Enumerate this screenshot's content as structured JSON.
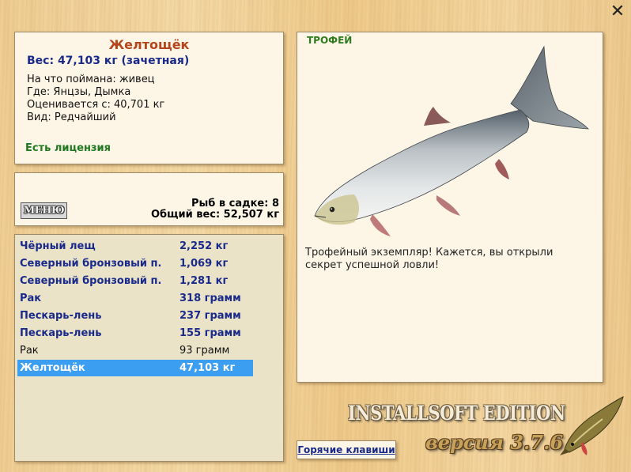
{
  "close_glyph": "✕",
  "fish_card": {
    "name": "Желтощёк",
    "weight_line": "Вес: 47,103 кг (зачетная)",
    "caught_on": "На что поймана: живец",
    "location": "Где: Янцзы, Дымка",
    "rated_from": "Оценивается с: 40,701 кг",
    "kind": "Вид: Редчайший",
    "license": "Есть лицензия"
  },
  "cage": {
    "menu_label": "МЕНЮ",
    "fish_count": "Рыб в садке: 8",
    "total_weight": "Общий вес: 52,507 кг"
  },
  "catch_list": [
    {
      "name": "Чёрный лещ",
      "weight": "2,252 кг",
      "style": "hi"
    },
    {
      "name": "Северный бронзовый п...",
      "weight": "1,069 кг",
      "style": "hi"
    },
    {
      "name": "Северный бронзовый п...",
      "weight": "1,281 кг",
      "style": "hi"
    },
    {
      "name": "Рак",
      "weight": "318 грамм",
      "style": "hi"
    },
    {
      "name": "Пескарь-лень",
      "weight": "237 грамм",
      "style": "hi"
    },
    {
      "name": "Пескарь-лень",
      "weight": "155 грамм",
      "style": "hi"
    },
    {
      "name": "Рак",
      "weight": "93 грамм",
      "style": "plain"
    },
    {
      "name": "Желтощёк",
      "weight": "47,103 кг",
      "style": "sel"
    }
  ],
  "trophy": {
    "label": "ТРОФЕЙ",
    "description": "Трофейный экземпляр! Кажется, вы открыли секрет успешной ловли!"
  },
  "branding": {
    "edition": "INSTALLSOFT EDITION",
    "version": "версия 3.7.6"
  },
  "hotkeys_label": "Горячие клавиши",
  "colors": {
    "accent_name": "#b5451b",
    "accent_blue": "#1a2a8a",
    "license_green": "#1f7a1f",
    "selection": "#3b9ef0"
  },
  "icons": {
    "close": "close-icon",
    "fish_image": "fish-trophy-image",
    "pike_logo": "pike-logo-icon"
  }
}
